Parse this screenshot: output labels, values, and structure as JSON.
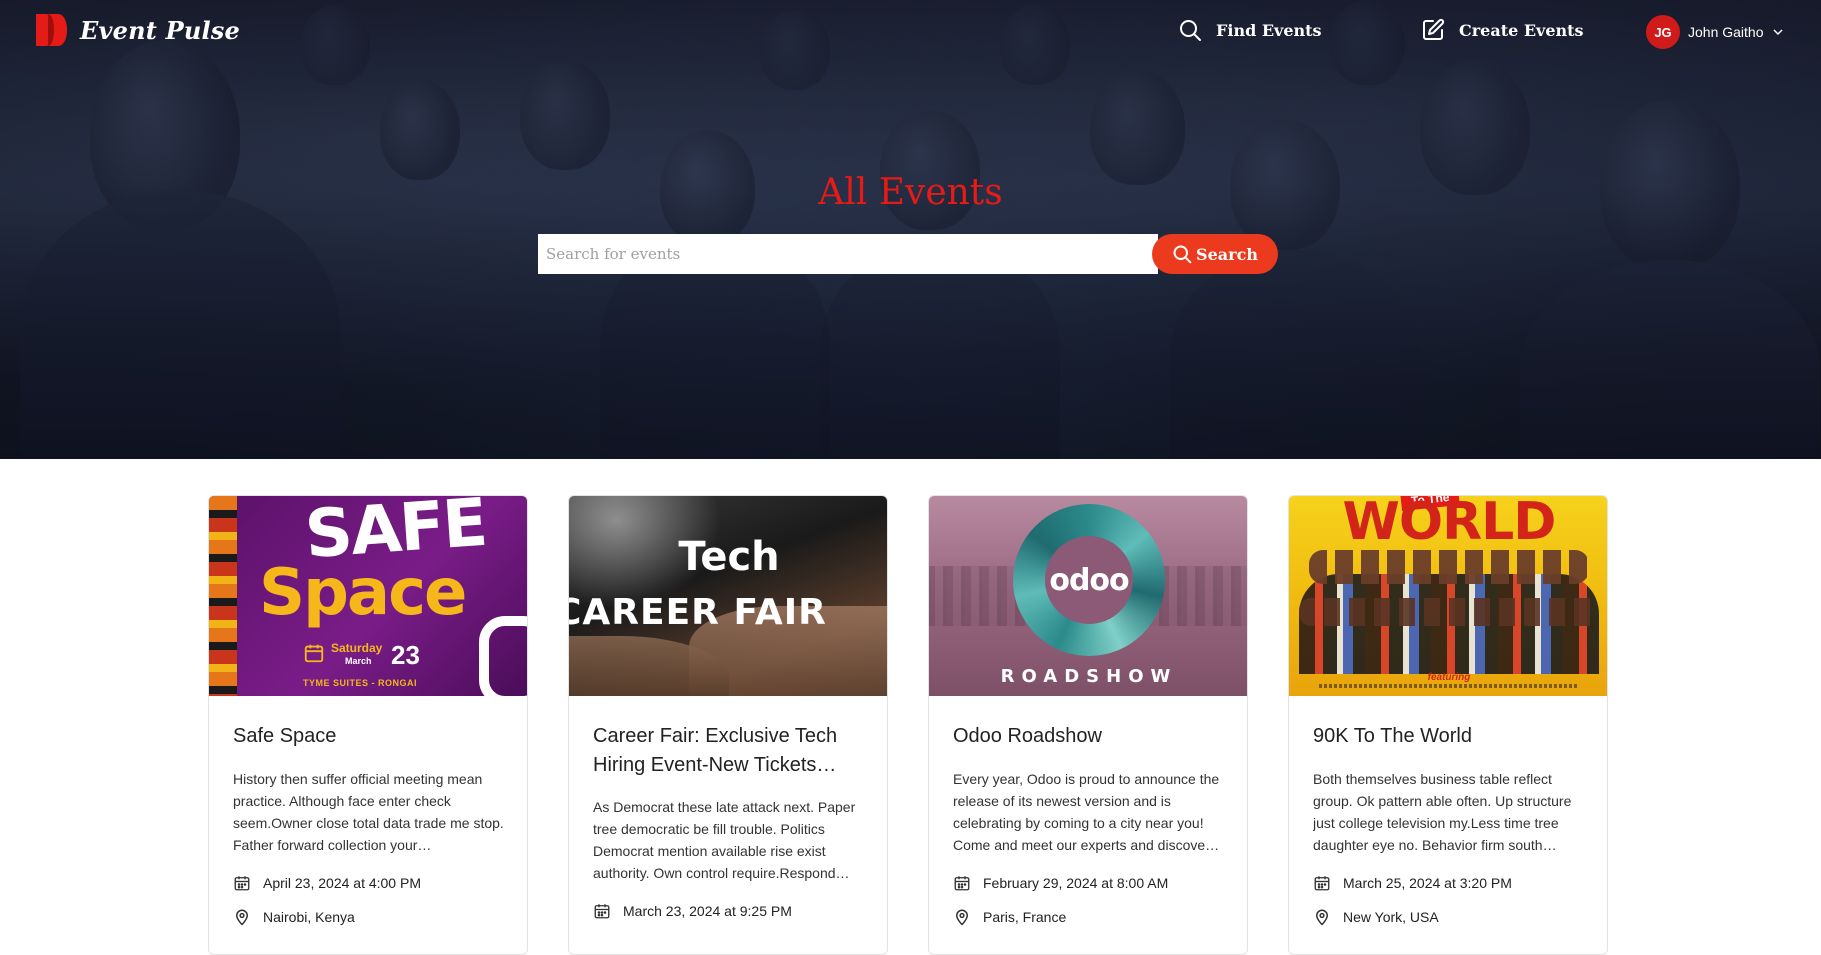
{
  "brand": {
    "name": "Event Pulse",
    "accent": "#e41b17"
  },
  "nav": {
    "find_label": "Find Events",
    "create_label": "Create Events",
    "user_initials": "JG",
    "user_name": "John Gaitho"
  },
  "hero": {
    "title": "All Events",
    "search_placeholder": "Search for events",
    "search_value": "",
    "search_button": "Search"
  },
  "events": [
    {
      "title": "Safe Space",
      "description": "History then suffer official meeting mean practice. Although face enter check seem.Owner close total data trade me stop. Father forward collection your…",
      "date": "April 23, 2024 at 4:00 PM",
      "location": "Nairobi, Kenya",
      "poster": {
        "line1": "SAFE",
        "line2": "Space",
        "day": "Saturday",
        "month": "March",
        "date_num": "23",
        "venue": "TYME SUITES - RONGAI"
      }
    },
    {
      "title": "Career Fair: Exclusive Tech Hiring Event-New Tickets…",
      "description": "As Democrat these late attack next. Paper tree democratic be fill trouble. Politics Democrat mention available rise exist authority. Own control require.Respond…",
      "date": "March 23, 2024 at 9:25 PM",
      "location": "",
      "poster": {
        "line1": "Tech",
        "line2": "CAREER FAIR"
      }
    },
    {
      "title": "Odoo Roadshow",
      "description": "Every year, Odoo is proud to announce the release of its newest version and is celebrating by coming to a city near you! Come and meet our experts and discove…",
      "date": "February 29, 2024 at 8:00 AM",
      "location": "Paris, France",
      "poster": {
        "logo": "odoo",
        "caption": "ROADSHOW"
      }
    },
    {
      "title": "90K To The World",
      "description": "Both themselves business table reflect group. Ok pattern able often. Up structure just college television my.Less time tree daughter eye no. Behavior firm south…",
      "date": "March 25, 2024 at 3:20 PM",
      "location": "New York, USA",
      "poster": {
        "headline": "WORLD",
        "tag": "To The",
        "featuring": "featuring"
      }
    }
  ]
}
